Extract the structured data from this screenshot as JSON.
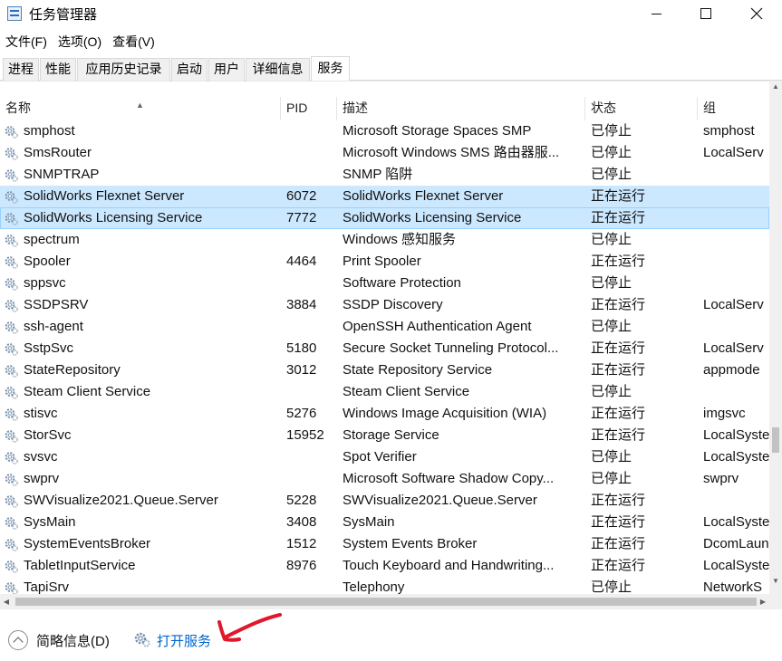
{
  "window": {
    "title": "任务管理器",
    "minimize_icon": "minimize-icon",
    "maximize_icon": "maximize-icon",
    "close_icon": "close-icon"
  },
  "menu": [
    "文件(F)",
    "选项(O)",
    "查看(V)"
  ],
  "tabs": [
    {
      "label": "进程"
    },
    {
      "label": "性能"
    },
    {
      "label": "应用历史记录"
    },
    {
      "label": "启动"
    },
    {
      "label": "用户"
    },
    {
      "label": "详细信息"
    },
    {
      "label": "服务",
      "active": true
    }
  ],
  "columns": {
    "name": "名称",
    "pid": "PID",
    "desc": "描述",
    "status": "状态",
    "group": "组"
  },
  "rows": [
    {
      "name": "smphost",
      "pid": "",
      "desc": "Microsoft Storage Spaces SMP",
      "status": "已停止",
      "group": "smphost"
    },
    {
      "name": "SmsRouter",
      "pid": "",
      "desc": "Microsoft Windows SMS 路由器服...",
      "status": "已停止",
      "group": "LocalServ"
    },
    {
      "name": "SNMPTRAP",
      "pid": "",
      "desc": "SNMP 陷阱",
      "status": "已停止",
      "group": ""
    },
    {
      "name": "SolidWorks Flexnet Server",
      "pid": "6072",
      "desc": "SolidWorks Flexnet Server",
      "status": "正在运行",
      "group": "",
      "selected": true
    },
    {
      "name": "SolidWorks Licensing Service",
      "pid": "7772",
      "desc": "SolidWorks Licensing Service",
      "status": "正在运行",
      "group": "",
      "selected": true,
      "focused": true
    },
    {
      "name": "spectrum",
      "pid": "",
      "desc": "Windows 感知服务",
      "status": "已停止",
      "group": ""
    },
    {
      "name": "Spooler",
      "pid": "4464",
      "desc": "Print Spooler",
      "status": "正在运行",
      "group": ""
    },
    {
      "name": "sppsvc",
      "pid": "",
      "desc": "Software Protection",
      "status": "已停止",
      "group": ""
    },
    {
      "name": "SSDPSRV",
      "pid": "3884",
      "desc": "SSDP Discovery",
      "status": "正在运行",
      "group": "LocalServ"
    },
    {
      "name": "ssh-agent",
      "pid": "",
      "desc": "OpenSSH Authentication Agent",
      "status": "已停止",
      "group": ""
    },
    {
      "name": "SstpSvc",
      "pid": "5180",
      "desc": "Secure Socket Tunneling Protocol...",
      "status": "正在运行",
      "group": "LocalServ"
    },
    {
      "name": "StateRepository",
      "pid": "3012",
      "desc": "State Repository Service",
      "status": "正在运行",
      "group": "appmode"
    },
    {
      "name": "Steam Client Service",
      "pid": "",
      "desc": "Steam Client Service",
      "status": "已停止",
      "group": ""
    },
    {
      "name": "stisvc",
      "pid": "5276",
      "desc": "Windows Image Acquisition (WIA)",
      "status": "正在运行",
      "group": "imgsvc"
    },
    {
      "name": "StorSvc",
      "pid": "15952",
      "desc": "Storage Service",
      "status": "正在运行",
      "group": "LocalSyste"
    },
    {
      "name": "svsvc",
      "pid": "",
      "desc": "Spot Verifier",
      "status": "已停止",
      "group": "LocalSyste"
    },
    {
      "name": "swprv",
      "pid": "",
      "desc": "Microsoft Software Shadow Copy...",
      "status": "已停止",
      "group": "swprv"
    },
    {
      "name": "SWVisualize2021.Queue.Server",
      "pid": "5228",
      "desc": "SWVisualize2021.Queue.Server",
      "status": "正在运行",
      "group": ""
    },
    {
      "name": "SysMain",
      "pid": "3408",
      "desc": "SysMain",
      "status": "正在运行",
      "group": "LocalSyste"
    },
    {
      "name": "SystemEventsBroker",
      "pid": "1512",
      "desc": "System Events Broker",
      "status": "正在运行",
      "group": "DcomLaun"
    },
    {
      "name": "TabletInputService",
      "pid": "8976",
      "desc": "Touch Keyboard and Handwriting...",
      "status": "正在运行",
      "group": "LocalSyste"
    },
    {
      "name": "TapiSrv",
      "pid": "",
      "desc": "Telephony",
      "status": "已停止",
      "group": "NetworkS"
    }
  ],
  "footer": {
    "fewer_details": "简略信息(D)",
    "open_services": "打开服务"
  },
  "colors": {
    "selected_row": "#cce8ff",
    "link": "#0066cc",
    "annotation": "#e0182c"
  }
}
